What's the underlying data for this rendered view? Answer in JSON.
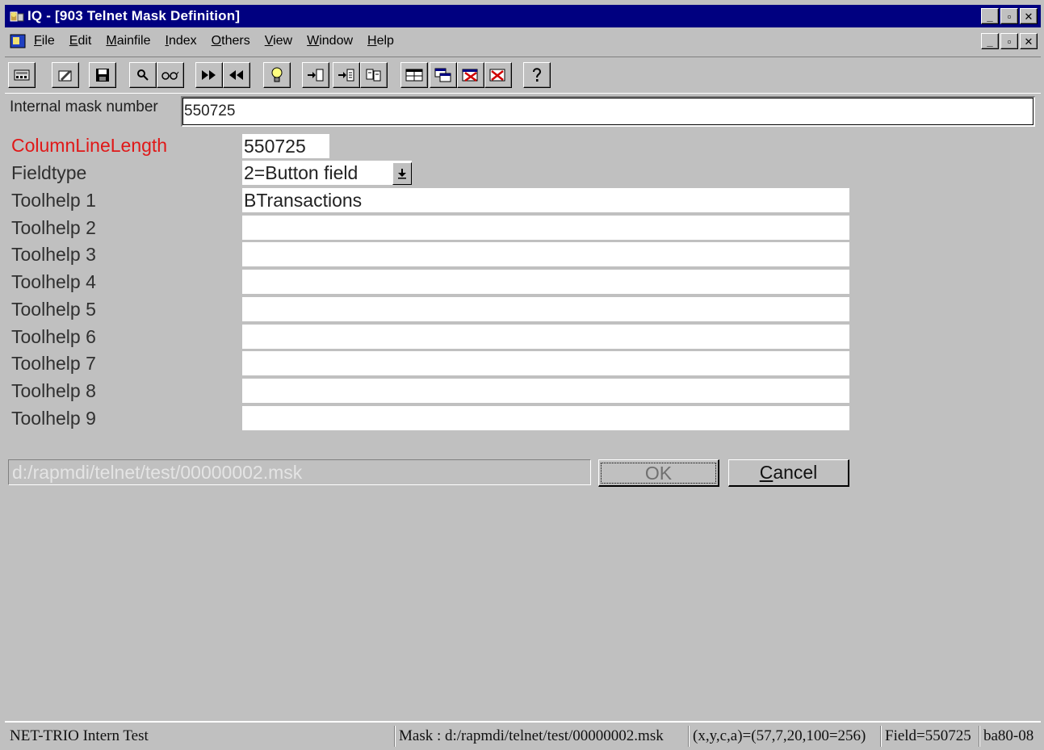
{
  "window": {
    "title": "IQ - [903  Telnet Mask Definition]",
    "buttons": {
      "minimize": "_",
      "maximize": "▫",
      "close": "✕"
    }
  },
  "menu": {
    "items": [
      {
        "label": "File",
        "key": "F",
        "rest": "ile"
      },
      {
        "label": "Edit",
        "key": "E",
        "rest": "dit"
      },
      {
        "label": "Mainfile",
        "key": "M",
        "rest": "ainfile"
      },
      {
        "label": "Index",
        "key": "I",
        "rest": "ndex"
      },
      {
        "label": "Others",
        "key": "O",
        "rest": "thers"
      },
      {
        "label": "View",
        "key": "V",
        "rest": "iew"
      },
      {
        "label": "Window",
        "key": "W",
        "rest": "indow"
      },
      {
        "label": "Help",
        "key": "H",
        "rest": "elp"
      }
    ]
  },
  "toolbar": {
    "icons": [
      "calculator-icon",
      "edit-note-icon",
      "save-icon",
      "search-icon",
      "glasses-icon",
      "next-icon",
      "previous-icon",
      "lightbulb-icon",
      "insert-icon",
      "append-icon",
      "copy-icon",
      "layout-icon",
      "windows-icon",
      "delete-icon",
      "close-doc-icon",
      "help-icon"
    ]
  },
  "form": {
    "internal_mask_label": "Internal mask number",
    "internal_mask_value": "550725",
    "column_line_length_label": "ColumnLineLength",
    "column_line_length_value": "550725",
    "fieldtype_label": "Fieldtype",
    "fieldtype_value": "2=Button field",
    "toolhelp": [
      {
        "label": "Toolhelp 1",
        "value": "BTransactions"
      },
      {
        "label": "Toolhelp 2",
        "value": ""
      },
      {
        "label": "Toolhelp 3",
        "value": ""
      },
      {
        "label": "Toolhelp 4",
        "value": ""
      },
      {
        "label": "Toolhelp 5",
        "value": ""
      },
      {
        "label": "Toolhelp 6",
        "value": ""
      },
      {
        "label": "Toolhelp 7",
        "value": ""
      },
      {
        "label": "Toolhelp 8",
        "value": ""
      },
      {
        "label": "Toolhelp 9",
        "value": ""
      }
    ],
    "path": "d:/rapmdi/telnet/test/00000002.msk",
    "ok_label": "OK",
    "cancel_label": "Cancel",
    "cancel_key": "C",
    "cancel_rest": "ancel"
  },
  "status": {
    "app": "NET-TRIO Intern Test",
    "mask": "Mask : d:/rapmdi/telnet/test/00000002.msk",
    "coords": "(x,y,c,a)=(57,7,20,100=256)",
    "field": "Field=550725",
    "code": "ba80-08"
  },
  "colors": {
    "titlebar": "#000080",
    "face": "#c0c0c0",
    "required_label": "#e01818"
  }
}
